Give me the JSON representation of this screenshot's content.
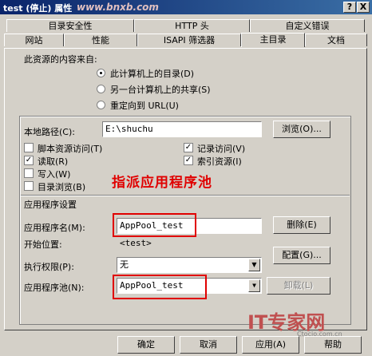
{
  "window": {
    "title": "test (停止) 属性",
    "help_btn": "?",
    "close_btn": "X"
  },
  "tabs_row1": [
    "目录安全性",
    "HTTP 头",
    "自定义错误"
  ],
  "tabs_row2": [
    "网站",
    "性能",
    "ISAPI 筛选器",
    "主目录",
    "文档"
  ],
  "content_source": {
    "heading": "此资源的内容来自:",
    "options": [
      "此计算机上的目录(D)",
      "另一台计算机上的共享(S)",
      "重定向到 URL(U)"
    ]
  },
  "local_path": {
    "label": "本地路径(C):",
    "value": "E:\\shuchu",
    "browse_btn": "浏览(O)..."
  },
  "checkboxes": {
    "script_access": "脚本资源访问(T)",
    "read": "读取(R)",
    "write": "写入(W)",
    "dir_browse": "目录浏览(B)",
    "log_visits": "记录访问(V)",
    "index_resource": "索引资源(I)"
  },
  "annotation": "指派应用程序池",
  "app_settings": {
    "heading": "应用程序设置",
    "app_name_label": "应用程序名(M):",
    "app_name_value": "AppPool_test",
    "remove_btn": "删除(E)",
    "start_label": "开始位置:",
    "start_value": "<test>",
    "config_btn": "配置(G)...",
    "exec_label": "执行权限(P):",
    "exec_value": "无",
    "pool_label": "应用程序池(N):",
    "pool_value": "AppPool_test",
    "unload_btn": "卸载(L)"
  },
  "watermark": {
    "top": "www.bnxb.com",
    "brand": "IT专家网",
    "sub": "Ctocio.com.cn"
  },
  "footer": {
    "ok": "确定",
    "cancel": "取消",
    "apply": "应用(A)",
    "help": "帮助"
  },
  "colors": {
    "red": "#e00000",
    "title_start": "#0a246a",
    "title_end": "#3a6ea5"
  }
}
